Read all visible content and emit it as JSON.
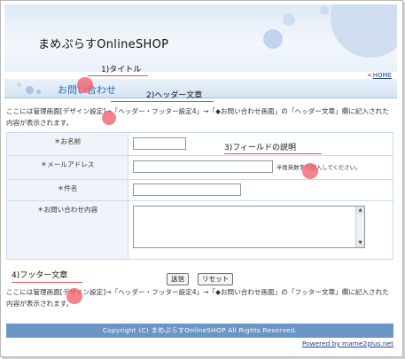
{
  "header": {
    "shop_title": "まめぷらすOnlineSHOP",
    "home_arrow": "<",
    "home_link": "HOME"
  },
  "page": {
    "title": "お問い合わせ",
    "header_text": "ここには管理画面[デザイン設定]→「ヘッダー・フッター設定4」→「◆お問い合わせ画面」の「ヘッダー文章」欄に記入された内容が表示されます。"
  },
  "form": {
    "fields": [
      {
        "label": "＊お名前",
        "value": ""
      },
      {
        "label": "＊メールアドレス",
        "value": "",
        "note": "半角英数字で記入してください。"
      },
      {
        "label": "＊件名",
        "value": ""
      },
      {
        "label": "＊お問い合わせ内容",
        "value": ""
      }
    ],
    "submit_label": "送信",
    "reset_label": "リセット"
  },
  "footer": {
    "text": "ここには管理画面[デザイン設定]→「ヘッダー・フッター設定4」→「◆お問い合わせ画面」の「フッター文章」欄に記入された内容が表示されます。",
    "copyright": "Copyright (C) まめぷらすOnlineSHOP All Rights Reserved.",
    "powered": "Powered by mame2plus.net"
  },
  "annotations": {
    "title": "1)タイトル",
    "header_text": "2)ヘッダー文章",
    "field_desc": "3)フィールドの説明",
    "footer_text": "4)フッター文章",
    "color": "#e0505a"
  }
}
